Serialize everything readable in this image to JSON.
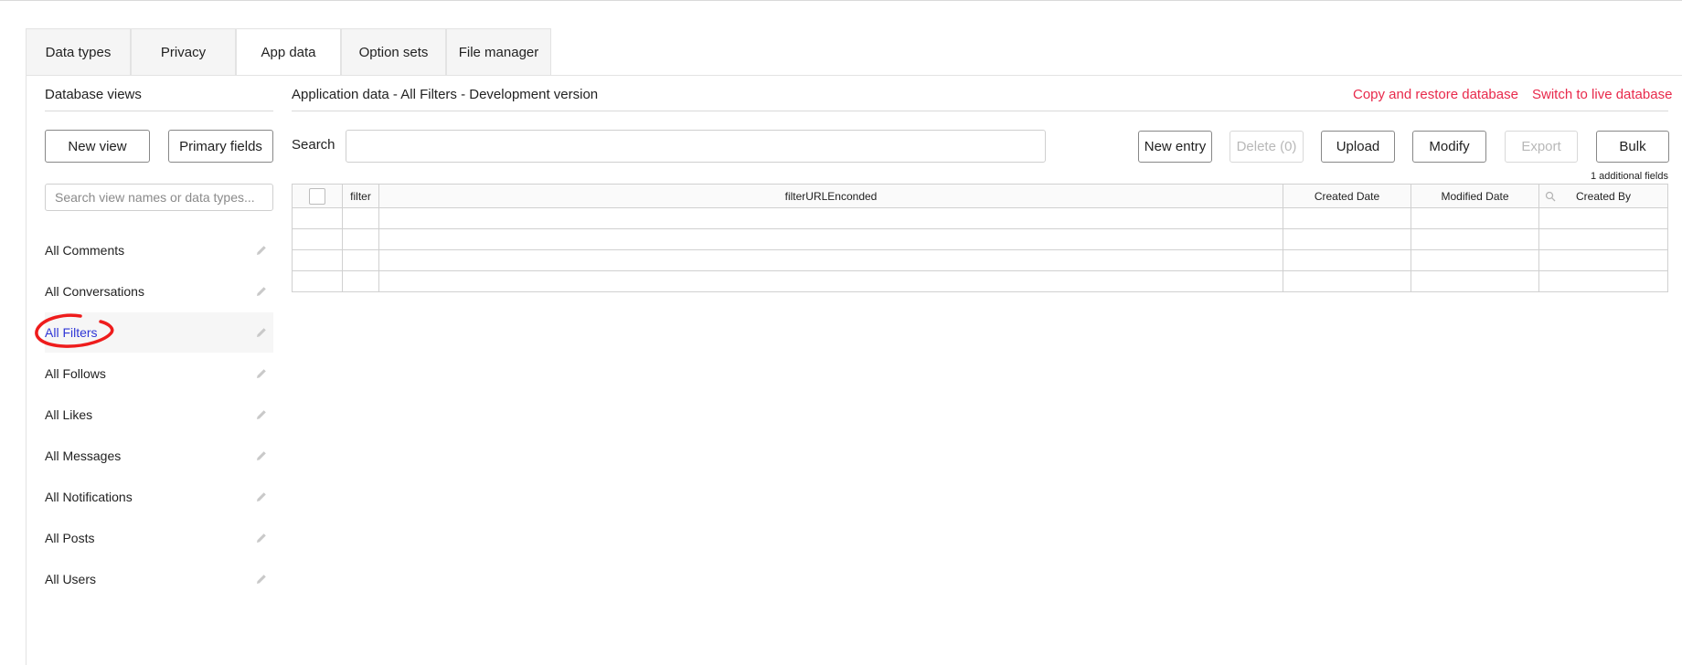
{
  "tabs": [
    {
      "label": "Data types"
    },
    {
      "label": "Privacy"
    },
    {
      "label": "App data"
    },
    {
      "label": "Option sets"
    },
    {
      "label": "File manager"
    }
  ],
  "active_tab": "App data",
  "sidebar": {
    "title": "Database views",
    "new_view_label": "New view",
    "primary_fields_label": "Primary fields",
    "search_placeholder": "Search view names or data types...",
    "items": [
      {
        "label": "All Comments",
        "icon": "pencil-icon"
      },
      {
        "label": "All Conversations",
        "icon": "pencil-icon"
      },
      {
        "label": "All Filters",
        "icon": "pencil-icon",
        "selected": true
      },
      {
        "label": "All Follows",
        "icon": "pencil-icon"
      },
      {
        "label": "All Likes",
        "icon": "pencil-icon"
      },
      {
        "label": "All Messages",
        "icon": "pencil-icon"
      },
      {
        "label": "All Notifications",
        "icon": "pencil-icon"
      },
      {
        "label": "All Posts",
        "icon": "pencil-icon"
      },
      {
        "label": "All Users",
        "icon": "pencil-icon"
      }
    ]
  },
  "main": {
    "title": "Application data - All Filters - Development version",
    "copy_restore_label": "Copy and restore database",
    "switch_live_label": "Switch to live database",
    "search_label": "Search",
    "search_value": "",
    "buttons": {
      "new_entry": "New entry",
      "delete": "Delete (0)",
      "upload": "Upload",
      "modify": "Modify",
      "export": "Export",
      "bulk": "Bulk"
    },
    "additional_fields": "1 additional fields",
    "table": {
      "columns": [
        "filter",
        "filterURLEnconded",
        "Created Date",
        "Modified Date",
        "Created By"
      ],
      "row_count_visible": 4
    }
  },
  "colors": {
    "accent_red": "#e8294b",
    "selected_blue": "#2f36d6",
    "annotation_red": "#ee1c1c"
  }
}
